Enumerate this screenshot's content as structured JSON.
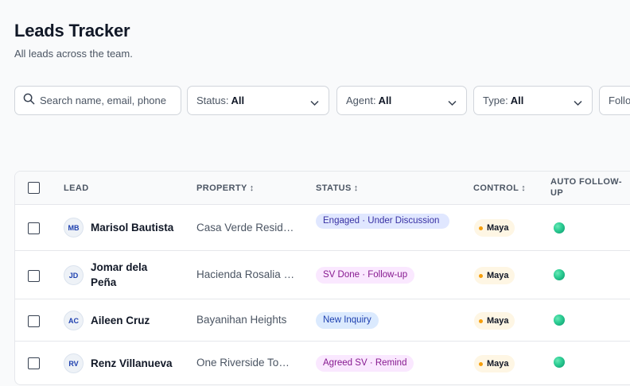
{
  "page": {
    "title": "Leads Tracker",
    "subtitle": "All leads across the team."
  },
  "filters": {
    "search_placeholder": "Search name, email, phone",
    "status": {
      "label": "Status:",
      "value": "All"
    },
    "agent": {
      "label": "Agent:",
      "value": "All"
    },
    "type": {
      "label": "Type:",
      "value": "All"
    },
    "followup": {
      "label": "Follo"
    }
  },
  "table": {
    "headers": {
      "lead": "Lead",
      "property": "Property",
      "status": "Status",
      "control": "Control",
      "auto_followup": "Auto Follow-up",
      "sort_glyph": "↕"
    },
    "rows": [
      {
        "initials": "MB",
        "name": "Marisol Bautista",
        "property": "Casa Verde Residences",
        "status": "Engaged · Under Discussion",
        "control": "Maya"
      },
      {
        "initials": "JD",
        "name": "Jomar dela Peña",
        "property": "Hacienda Rosalia Estates",
        "status": "SV Done · Follow-up",
        "control": "Maya"
      },
      {
        "initials": "AC",
        "name": "Aileen Cruz",
        "property": "Bayanihan Heights",
        "status": "New Inquiry",
        "control": "Maya"
      },
      {
        "initials": "RV",
        "name": "Renz Villanueva",
        "property": "One Riverside Tower",
        "status": "Agreed SV · Remind",
        "control": "Maya"
      }
    ]
  },
  "colors": {
    "accent_green": "#34d399",
    "control_dot": "#f59e0b",
    "status_engaged_bg": "#e0e7ff",
    "status_sv_bg": "#fae8ff",
    "status_new_bg": "#dbeafe"
  },
  "icons": {
    "search": "search-icon",
    "chevron": "chevron-down-icon"
  }
}
